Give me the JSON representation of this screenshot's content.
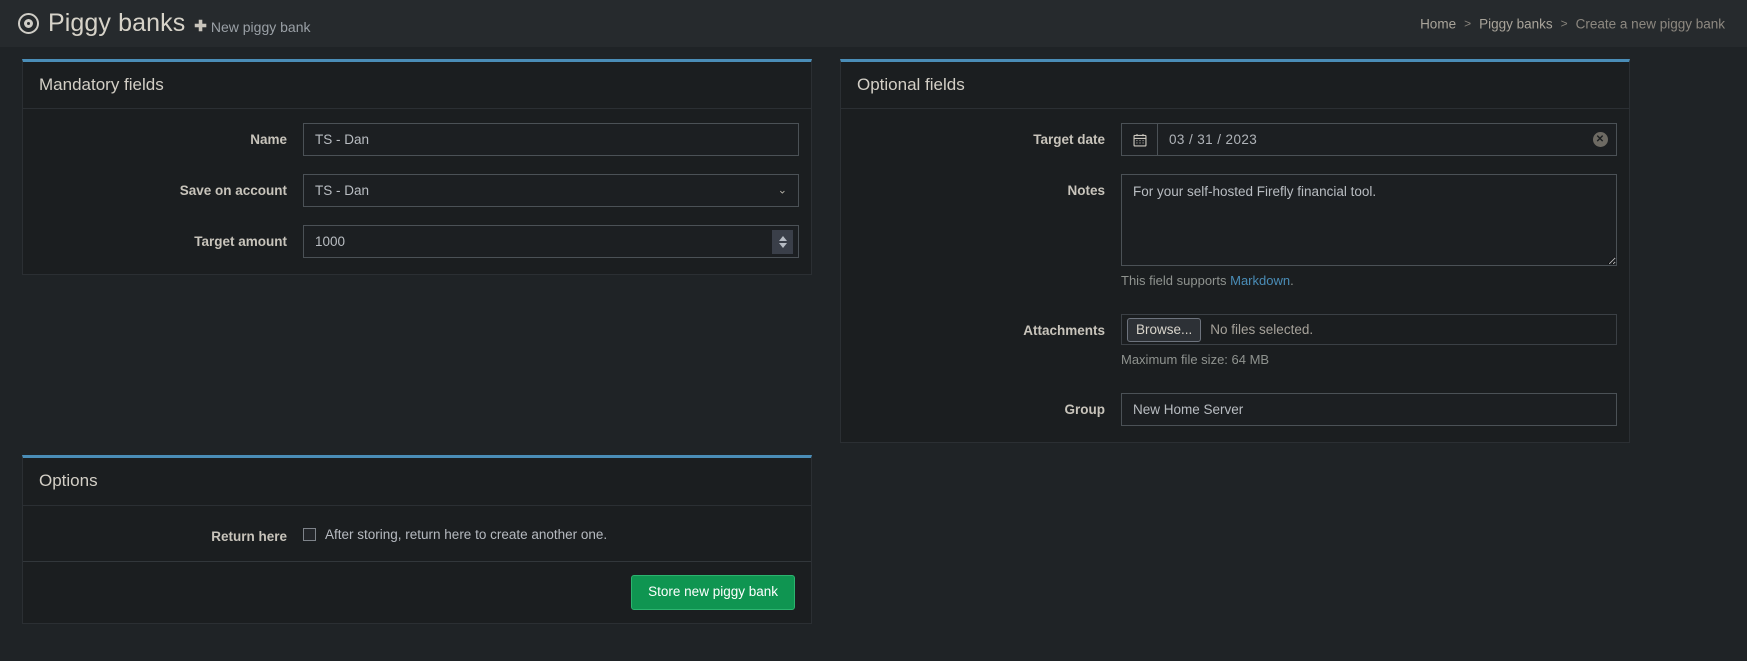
{
  "header": {
    "icon": "target-icon",
    "title": "Piggy banks",
    "new_link_plus": "✚",
    "new_link_label": "New piggy bank",
    "breadcrumb": {
      "home": "Home",
      "sep1": ">",
      "parent": "Piggy banks",
      "sep2": ">",
      "current": "Create a new piggy bank"
    }
  },
  "mandatory": {
    "title": "Mandatory fields",
    "name": {
      "label": "Name",
      "value": "TS - Dan",
      "placeholder": "Name"
    },
    "account": {
      "label": "Save on account",
      "value": "TS - Dan",
      "chevron": "⌄"
    },
    "amount": {
      "label": "Target amount",
      "value": "1000",
      "placeholder": "Target amount"
    }
  },
  "optional": {
    "title": "Optional fields",
    "target_date": {
      "label": "Target date",
      "calendar_icon": "▦",
      "value": "03 / 31 / 2023",
      "clear_icon": "✕"
    },
    "notes": {
      "label": "Notes",
      "value": "For your self-hosted Firefly financial tool.",
      "help_prefix": "This field supports ",
      "help_link": "Markdown",
      "help_suffix": "."
    },
    "attachments": {
      "label": "Attachments",
      "browse_label": "Browse...",
      "file_status": "No files selected.",
      "max_size": "Maximum file size: 64 MB"
    },
    "group": {
      "label": "Group",
      "value": "New Home Server",
      "placeholder": "Group"
    }
  },
  "options": {
    "title": "Options",
    "return_here": {
      "label": "Return here",
      "checkbox_text": "After storing, return here to create another one.",
      "checked": false
    },
    "submit_label": "Store new piggy bank"
  },
  "colors": {
    "accent": "#4a8db7",
    "success": "#0f9551",
    "link": "#4a8db7",
    "page_bg": "#1f2326",
    "card_bg": "#1b1e20"
  }
}
